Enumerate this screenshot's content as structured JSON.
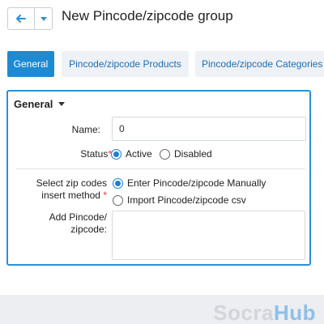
{
  "header": {
    "title": "New Pincode/zipcode group"
  },
  "tabs": [
    {
      "label": "General",
      "active": true
    },
    {
      "label": "Pincode/zipcode Products",
      "active": false
    },
    {
      "label": "Pincode/zipcode Categories",
      "active": false
    }
  ],
  "panel": {
    "title": "General",
    "name": {
      "label": "Name:",
      "value": "0"
    },
    "status": {
      "label": "Status",
      "required_mark": "*",
      "options": [
        "Active",
        "Disabled"
      ],
      "selected": "Active"
    },
    "method": {
      "label_line1": "Select zip codes",
      "label_line2": "insert  method",
      "required_mark": "*",
      "options": [
        "Enter Pincode/zipcode Manually",
        "Import Pincode/zipcode csv"
      ],
      "selected": "Enter Pincode/zipcode Manually"
    },
    "add": {
      "label_line1": "Add Pincode/",
      "label_line2": "zipcode:",
      "value": ""
    }
  },
  "watermark": {
    "part1": "Socra",
    "part2": "Hub"
  },
  "colors": {
    "accent": "#1e8ad2",
    "panel_border": "#2b8fd6",
    "required": "#e0393e"
  }
}
